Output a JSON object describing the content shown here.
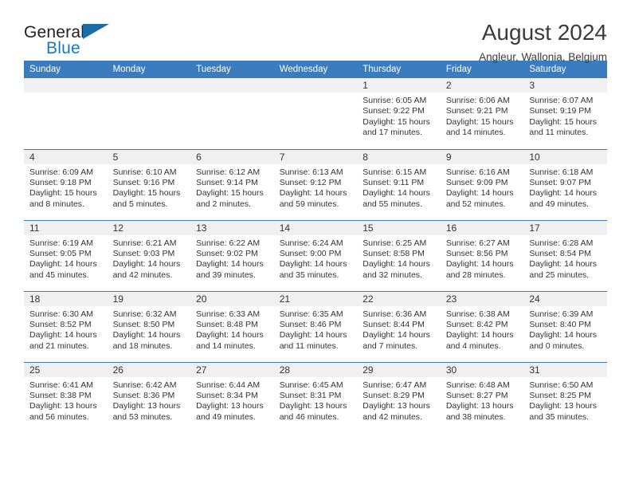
{
  "brand": {
    "name_part1": "General",
    "name_part2": "Blue",
    "flag_icon": "triangle-flag-icon"
  },
  "header": {
    "month_title": "August 2024",
    "location": "Angleur, Wallonia, Belgium"
  },
  "colors": {
    "header_blue": "#3a7cbe",
    "brand_blue": "#1878be",
    "daynum_bg": "#f0f0f0",
    "text": "#333333"
  },
  "calendar": {
    "weekday_headers": [
      "Sunday",
      "Monday",
      "Tuesday",
      "Wednesday",
      "Thursday",
      "Friday",
      "Saturday"
    ],
    "weeks": [
      [
        {
          "day": "",
          "sunrise": "",
          "sunset": "",
          "daylight_line1": "",
          "daylight_line2": "",
          "empty": true
        },
        {
          "day": "",
          "sunrise": "",
          "sunset": "",
          "daylight_line1": "",
          "daylight_line2": "",
          "empty": true
        },
        {
          "day": "",
          "sunrise": "",
          "sunset": "",
          "daylight_line1": "",
          "daylight_line2": "",
          "empty": true
        },
        {
          "day": "",
          "sunrise": "",
          "sunset": "",
          "daylight_line1": "",
          "daylight_line2": "",
          "empty": true
        },
        {
          "day": "1",
          "sunrise": "Sunrise: 6:05 AM",
          "sunset": "Sunset: 9:22 PM",
          "daylight_line1": "Daylight: 15 hours",
          "daylight_line2": "and 17 minutes."
        },
        {
          "day": "2",
          "sunrise": "Sunrise: 6:06 AM",
          "sunset": "Sunset: 9:21 PM",
          "daylight_line1": "Daylight: 15 hours",
          "daylight_line2": "and 14 minutes."
        },
        {
          "day": "3",
          "sunrise": "Sunrise: 6:07 AM",
          "sunset": "Sunset: 9:19 PM",
          "daylight_line1": "Daylight: 15 hours",
          "daylight_line2": "and 11 minutes."
        }
      ],
      [
        {
          "day": "4",
          "sunrise": "Sunrise: 6:09 AM",
          "sunset": "Sunset: 9:18 PM",
          "daylight_line1": "Daylight: 15 hours",
          "daylight_line2": "and 8 minutes."
        },
        {
          "day": "5",
          "sunrise": "Sunrise: 6:10 AM",
          "sunset": "Sunset: 9:16 PM",
          "daylight_line1": "Daylight: 15 hours",
          "daylight_line2": "and 5 minutes."
        },
        {
          "day": "6",
          "sunrise": "Sunrise: 6:12 AM",
          "sunset": "Sunset: 9:14 PM",
          "daylight_line1": "Daylight: 15 hours",
          "daylight_line2": "and 2 minutes."
        },
        {
          "day": "7",
          "sunrise": "Sunrise: 6:13 AM",
          "sunset": "Sunset: 9:12 PM",
          "daylight_line1": "Daylight: 14 hours",
          "daylight_line2": "and 59 minutes."
        },
        {
          "day": "8",
          "sunrise": "Sunrise: 6:15 AM",
          "sunset": "Sunset: 9:11 PM",
          "daylight_line1": "Daylight: 14 hours",
          "daylight_line2": "and 55 minutes."
        },
        {
          "day": "9",
          "sunrise": "Sunrise: 6:16 AM",
          "sunset": "Sunset: 9:09 PM",
          "daylight_line1": "Daylight: 14 hours",
          "daylight_line2": "and 52 minutes."
        },
        {
          "day": "10",
          "sunrise": "Sunrise: 6:18 AM",
          "sunset": "Sunset: 9:07 PM",
          "daylight_line1": "Daylight: 14 hours",
          "daylight_line2": "and 49 minutes."
        }
      ],
      [
        {
          "day": "11",
          "sunrise": "Sunrise: 6:19 AM",
          "sunset": "Sunset: 9:05 PM",
          "daylight_line1": "Daylight: 14 hours",
          "daylight_line2": "and 45 minutes."
        },
        {
          "day": "12",
          "sunrise": "Sunrise: 6:21 AM",
          "sunset": "Sunset: 9:03 PM",
          "daylight_line1": "Daylight: 14 hours",
          "daylight_line2": "and 42 minutes."
        },
        {
          "day": "13",
          "sunrise": "Sunrise: 6:22 AM",
          "sunset": "Sunset: 9:02 PM",
          "daylight_line1": "Daylight: 14 hours",
          "daylight_line2": "and 39 minutes."
        },
        {
          "day": "14",
          "sunrise": "Sunrise: 6:24 AM",
          "sunset": "Sunset: 9:00 PM",
          "daylight_line1": "Daylight: 14 hours",
          "daylight_line2": "and 35 minutes."
        },
        {
          "day": "15",
          "sunrise": "Sunrise: 6:25 AM",
          "sunset": "Sunset: 8:58 PM",
          "daylight_line1": "Daylight: 14 hours",
          "daylight_line2": "and 32 minutes."
        },
        {
          "day": "16",
          "sunrise": "Sunrise: 6:27 AM",
          "sunset": "Sunset: 8:56 PM",
          "daylight_line1": "Daylight: 14 hours",
          "daylight_line2": "and 28 minutes."
        },
        {
          "day": "17",
          "sunrise": "Sunrise: 6:28 AM",
          "sunset": "Sunset: 8:54 PM",
          "daylight_line1": "Daylight: 14 hours",
          "daylight_line2": "and 25 minutes."
        }
      ],
      [
        {
          "day": "18",
          "sunrise": "Sunrise: 6:30 AM",
          "sunset": "Sunset: 8:52 PM",
          "daylight_line1": "Daylight: 14 hours",
          "daylight_line2": "and 21 minutes."
        },
        {
          "day": "19",
          "sunrise": "Sunrise: 6:32 AM",
          "sunset": "Sunset: 8:50 PM",
          "daylight_line1": "Daylight: 14 hours",
          "daylight_line2": "and 18 minutes."
        },
        {
          "day": "20",
          "sunrise": "Sunrise: 6:33 AM",
          "sunset": "Sunset: 8:48 PM",
          "daylight_line1": "Daylight: 14 hours",
          "daylight_line2": "and 14 minutes."
        },
        {
          "day": "21",
          "sunrise": "Sunrise: 6:35 AM",
          "sunset": "Sunset: 8:46 PM",
          "daylight_line1": "Daylight: 14 hours",
          "daylight_line2": "and 11 minutes."
        },
        {
          "day": "22",
          "sunrise": "Sunrise: 6:36 AM",
          "sunset": "Sunset: 8:44 PM",
          "daylight_line1": "Daylight: 14 hours",
          "daylight_line2": "and 7 minutes."
        },
        {
          "day": "23",
          "sunrise": "Sunrise: 6:38 AM",
          "sunset": "Sunset: 8:42 PM",
          "daylight_line1": "Daylight: 14 hours",
          "daylight_line2": "and 4 minutes."
        },
        {
          "day": "24",
          "sunrise": "Sunrise: 6:39 AM",
          "sunset": "Sunset: 8:40 PM",
          "daylight_line1": "Daylight: 14 hours",
          "daylight_line2": "and 0 minutes."
        }
      ],
      [
        {
          "day": "25",
          "sunrise": "Sunrise: 6:41 AM",
          "sunset": "Sunset: 8:38 PM",
          "daylight_line1": "Daylight: 13 hours",
          "daylight_line2": "and 56 minutes."
        },
        {
          "day": "26",
          "sunrise": "Sunrise: 6:42 AM",
          "sunset": "Sunset: 8:36 PM",
          "daylight_line1": "Daylight: 13 hours",
          "daylight_line2": "and 53 minutes."
        },
        {
          "day": "27",
          "sunrise": "Sunrise: 6:44 AM",
          "sunset": "Sunset: 8:34 PM",
          "daylight_line1": "Daylight: 13 hours",
          "daylight_line2": "and 49 minutes."
        },
        {
          "day": "28",
          "sunrise": "Sunrise: 6:45 AM",
          "sunset": "Sunset: 8:31 PM",
          "daylight_line1": "Daylight: 13 hours",
          "daylight_line2": "and 46 minutes."
        },
        {
          "day": "29",
          "sunrise": "Sunrise: 6:47 AM",
          "sunset": "Sunset: 8:29 PM",
          "daylight_line1": "Daylight: 13 hours",
          "daylight_line2": "and 42 minutes."
        },
        {
          "day": "30",
          "sunrise": "Sunrise: 6:48 AM",
          "sunset": "Sunset: 8:27 PM",
          "daylight_line1": "Daylight: 13 hours",
          "daylight_line2": "and 38 minutes."
        },
        {
          "day": "31",
          "sunrise": "Sunrise: 6:50 AM",
          "sunset": "Sunset: 8:25 PM",
          "daylight_line1": "Daylight: 13 hours",
          "daylight_line2": "and 35 minutes."
        }
      ]
    ]
  }
}
